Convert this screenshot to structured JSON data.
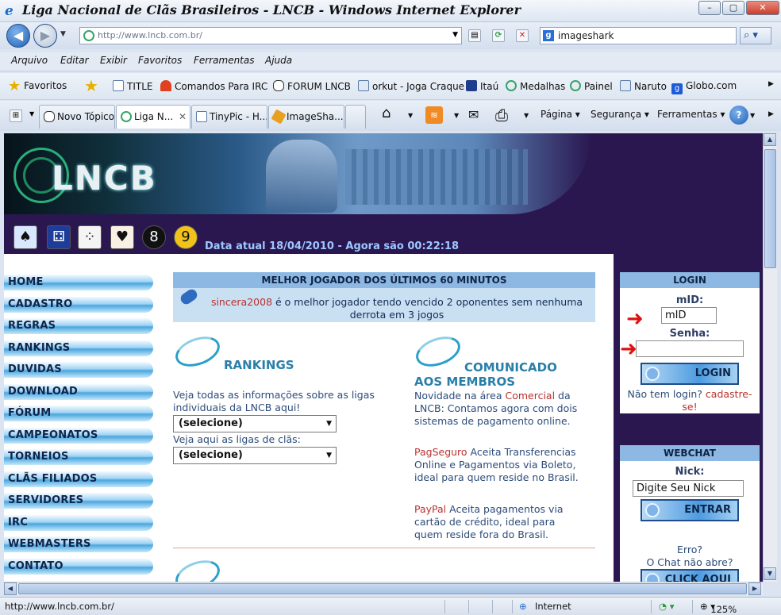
{
  "window": {
    "title": "Liga Nacional de Clãs Brasileiros - LNCB - Windows Internet Explorer"
  },
  "address": {
    "url": "http://www.lncb.com.br/"
  },
  "search": {
    "value": "imageshark"
  },
  "menu": [
    "Arquivo",
    "Editar",
    "Exibir",
    "Favoritos",
    "Ferramentas",
    "Ajuda"
  ],
  "favorites": {
    "label": "Favoritos",
    "items": [
      "TITLE",
      "Comandos Para IRC",
      "FORUM LNCB",
      "orkut - Joga Craque",
      "Itaú",
      "Medalhas",
      "Painel",
      "Naruto",
      "Globo.com"
    ]
  },
  "tabs": {
    "items": [
      "Novo Tópico",
      "Liga N...",
      "TinyPic - H...",
      "ImageSha..."
    ],
    "commands": [
      "Página",
      "Segurança",
      "Ferramentas"
    ]
  },
  "banner": {
    "logo": "LNCB",
    "date_text": "Data atual 18/04/2010 - Agora são 00:22:18"
  },
  "leftnav": [
    "HOME",
    "CADASTRO",
    "REGRAS",
    "RANKINGS",
    "DUVIDAS",
    "DOWNLOAD",
    "FÓRUM",
    "CAMPEONATOS",
    "TORNEIOS",
    "CLÃS FILIADOS",
    "SERVIDORES",
    "IRC",
    "WEBMASTERS",
    "CONTATO"
  ],
  "best_player": {
    "header": "MELHOR JOGADOR DOS ÚLTIMOS 60 MINUTOS",
    "player": "sincera2008",
    "text": " é o melhor jogador tendo vencido 2 oponentes sem nenhuma derrota em 3 jogos"
  },
  "rankings": {
    "title": "RANKINGS",
    "desc": "Veja todas as informações sobre as ligas individuais da LNCB aqui!",
    "select1": "(selecione)",
    "label2": "Veja aqui as ligas de clãs:",
    "select2": "(selecione)"
  },
  "comunicado": {
    "title_line1": "COMUNICADO",
    "title_line2": "AOS MEMBROS",
    "p1_a": "Novidade na área ",
    "p1_link": "Comercial",
    "p1_b": " da LNCB: Contamos agora com dois sistemas de pagamento online.",
    "p2_link": "PagSeguro",
    "p2_b": " Aceita Transferencias Online e Pagamentos via Boleto, ideal para quem reside no Brasil.",
    "p3_link": "PayPal",
    "p3_b": " Aceita pagamentos via cartão de crédito, ideal para quem reside fora do Brasil."
  },
  "login": {
    "header": "LOGIN",
    "mid_label": "mID:",
    "mid_value": "mID",
    "senha_label": "Senha:",
    "button": "LOGIN",
    "no_login": "Não tem login? ",
    "register": "cadastre-se!"
  },
  "webchat": {
    "header": "WEBCHAT",
    "nick_label": "Nick:",
    "nick_value": "Digite Seu Nick",
    "button": "ENTRAR",
    "help1": "Erro?",
    "help2": "O Chat não abre?",
    "click": "CLICK AQUI"
  },
  "status": {
    "url": "http://www.lncb.com.br/",
    "zone": "Internet",
    "zoom": "125%"
  }
}
